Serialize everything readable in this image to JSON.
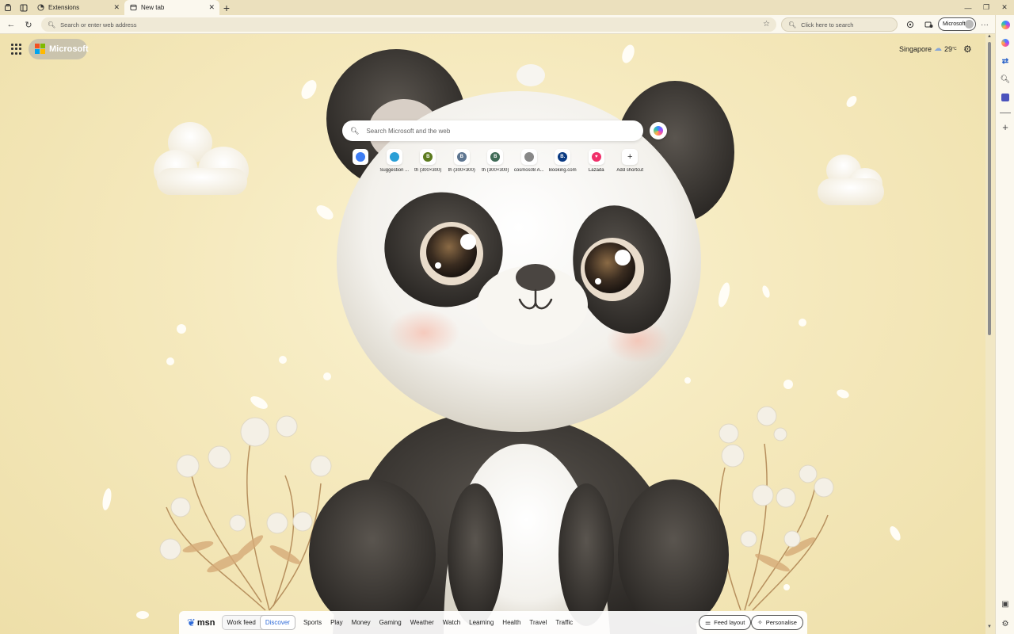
{
  "tabs": [
    {
      "label": "Extensions",
      "icon": "extensions-icon",
      "active": false
    },
    {
      "label": "New tab",
      "icon": "page-icon",
      "active": true
    }
  ],
  "toolbar": {
    "address_placeholder": "Search or enter web address",
    "search_placeholder": "Click here to search",
    "profile_label": "Microsoft"
  },
  "brand": {
    "name": "Microsoft"
  },
  "weather": {
    "city": "Singapore",
    "temp": "29",
    "unit": "°C"
  },
  "ntp_search": {
    "placeholder": "Search Microsoft and the web"
  },
  "shortcuts": [
    {
      "label": "",
      "letter": "",
      "color": "#3d7df5"
    },
    {
      "label": "Suggestion ...",
      "letter": "",
      "color": "#2a9fd6"
    },
    {
      "label": "th (300×300)",
      "letter": "B",
      "color": "#5c7a1e"
    },
    {
      "label": "th (300×300)",
      "letter": "B",
      "color": "#5d7590"
    },
    {
      "label": "th (300×300)",
      "letter": "B",
      "color": "#3f6a56"
    },
    {
      "label": "cosmos08 A...",
      "letter": "",
      "color": "#888888"
    },
    {
      "label": "Booking.com",
      "letter": "B.",
      "color": "#0a3a82"
    },
    {
      "label": "Lazada",
      "letter": "♥",
      "color": "#f0306a"
    },
    {
      "label": "Add shortcut",
      "letter": "+",
      "color": "#ffffff"
    }
  ],
  "feed": {
    "brand": "msn",
    "segments": [
      "Work feed",
      "Discover"
    ],
    "active_segment": "Discover",
    "nav": [
      "Sports",
      "Play",
      "Money",
      "Gaming",
      "Weather",
      "Watch",
      "Learning",
      "Health",
      "Travel",
      "Traffic"
    ],
    "layout_label": "Feed layout",
    "personalise_label": "Personalise"
  },
  "colors": {
    "accent": "#2f6bd8",
    "ms_red": "#f25022",
    "ms_green": "#7fba00",
    "ms_blue": "#00a4ef",
    "ms_yellow": "#ffb900"
  }
}
